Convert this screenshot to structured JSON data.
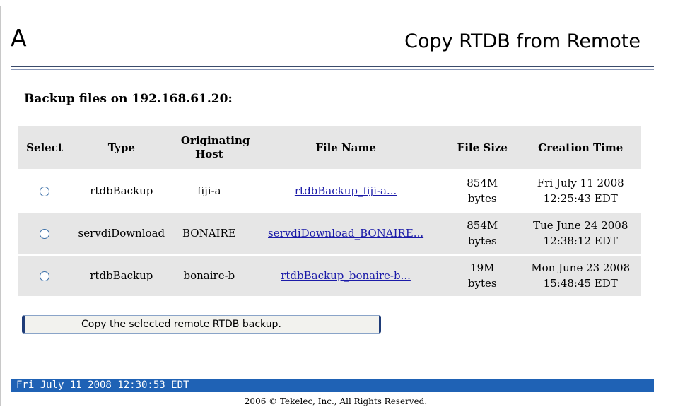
{
  "header": {
    "letter": "A",
    "title": "Copy RTDB from Remote"
  },
  "section": {
    "heading": "Backup files on 192.168.61.20:"
  },
  "table": {
    "columns": [
      "Select",
      "Type",
      "Originating Host",
      "File Name",
      "File Size",
      "Creation Time"
    ],
    "rows": [
      {
        "type": "rtdbBackup",
        "host": "fiji-a",
        "file_name": "rtdbBackup_fiji-a...",
        "file_size_value": "854M",
        "file_size_unit": "bytes",
        "created_date": "Fri July 11 2008",
        "created_time": "12:25:43 EDT"
      },
      {
        "type": "servdiDownload",
        "host": "BONAIRE",
        "file_name": "servdiDownload_BONAIRE...",
        "file_size_value": "854M",
        "file_size_unit": "bytes",
        "created_date": "Tue June 24 2008",
        "created_time": "12:38:12 EDT"
      },
      {
        "type": "rtdbBackup",
        "host": "bonaire-b",
        "file_name": "rtdbBackup_bonaire-b...",
        "file_size_value": "19M",
        "file_size_unit": "bytes",
        "created_date": "Mon June 23 2008",
        "created_time": "15:48:45 EDT"
      }
    ]
  },
  "actions": {
    "copy_label": "Copy the selected remote RTDB backup."
  },
  "status_bar": {
    "datetime": "Fri July 11 2008 12:30:53 EDT"
  },
  "footer": {
    "copyright": "2006 © Tekelec, Inc., All Rights Reserved."
  },
  "colors": {
    "status_bar_bg": "#1f62b5",
    "link": "#1a1aa8",
    "header_row_bg": "#e6e6e6"
  }
}
